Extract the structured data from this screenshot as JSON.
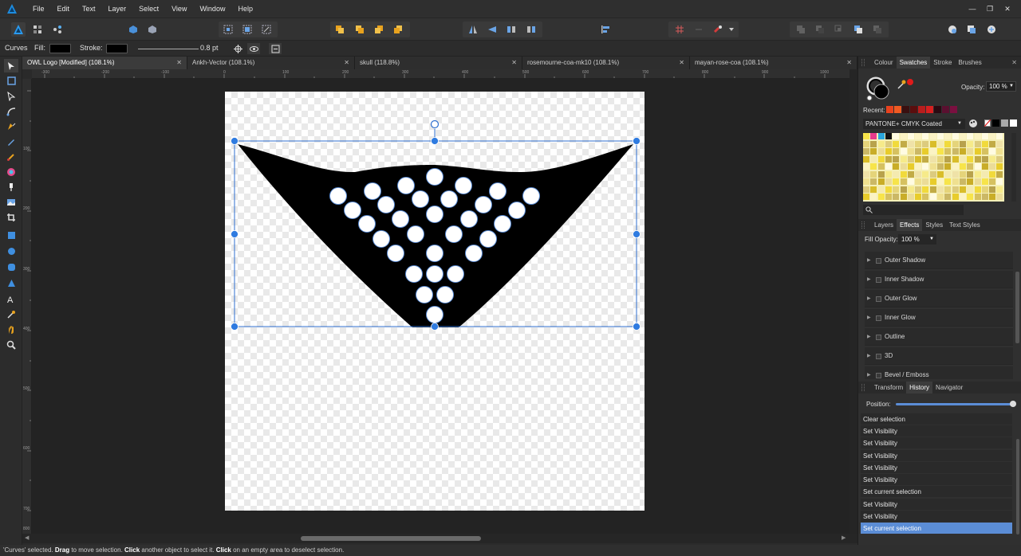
{
  "menubar": {
    "items": [
      "File",
      "Edit",
      "Text",
      "Layer",
      "Select",
      "View",
      "Window",
      "Help"
    ]
  },
  "context": {
    "tool": "Curves",
    "fill_label": "Fill:",
    "stroke_label": "Stroke:",
    "stroke_width": "0.8 pt"
  },
  "tabs": [
    "OWL Logo [Modified] (108.1%)",
    "Ankh-Vector (108.1%)",
    "skull (118.8%)",
    "rosemourne-coa-mk10 (108.1%)",
    "mayan-rose-coa (108.1%)"
  ],
  "ruler": {
    "h_labels": [
      "-300",
      "-200",
      "-100",
      "0",
      "100",
      "200",
      "300",
      "400",
      "500",
      "600",
      "700",
      "800",
      "900",
      "1000"
    ],
    "v_labels": [
      "100",
      "200",
      "300",
      "400",
      "500",
      "600",
      "700",
      "800"
    ]
  },
  "colour_panel": {
    "tabs": [
      "Colour",
      "Swatches",
      "Stroke",
      "Brushes"
    ],
    "active_tab": "Swatches",
    "opacity_label": "Opacity:",
    "opacity_value": "100 %",
    "recent_label": "Recent:",
    "palette_name": "PANTONE+ CMYK Coated",
    "recent_colors": [
      "#e8421e",
      "#f05a22",
      "#3a1010",
      "#5a0e0e",
      "#b81d1d",
      "#d62020",
      "#2a0a12",
      "#5a1030",
      "#7a1040"
    ]
  },
  "effects_panel": {
    "tabs": [
      "Layers",
      "Effects",
      "Styles",
      "Text Styles"
    ],
    "active_tab": "Effects",
    "fill_opacity_label": "Fill Opacity:",
    "fill_opacity_value": "100 %",
    "effects": [
      "Outer Shadow",
      "Inner Shadow",
      "Outer Glow",
      "Inner Glow",
      "Outline",
      "3D",
      "Bevel / Emboss"
    ]
  },
  "history_panel": {
    "tabs": [
      "Transform",
      "History",
      "Navigator"
    ],
    "active_tab": "History",
    "position_label": "Position:",
    "items": [
      "Clear selection",
      "Set Visibility",
      "Set Visibility",
      "Set Visibility",
      "Set Visibility",
      "Set Visibility",
      "Set current selection",
      "Set Visibility",
      "Set Visibility",
      "Set current selection"
    ],
    "selected_index": 9
  },
  "status": {
    "prefix": "'Curves' selected. ",
    "drag": "Drag",
    "t1": " to move selection. ",
    "click1": "Click",
    "t2": " another object to select it. ",
    "click2": "Click",
    "t3": " on an empty area to deselect selection."
  },
  "colors": {
    "accent": "#5b8dd6",
    "selection": "#2f6fcf",
    "fill": "#000000",
    "stroke_swatch": "#000000"
  }
}
